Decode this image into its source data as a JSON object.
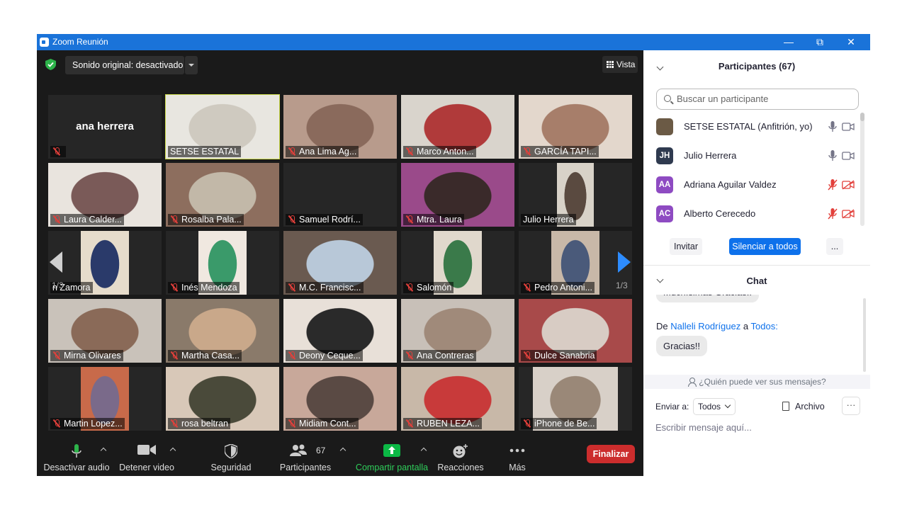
{
  "window": {
    "title": "Zoom Reunión",
    "minimize": "—",
    "restore": "⧉",
    "close": "✕"
  },
  "meeting": {
    "sound_original": "Sonido original: desactivado",
    "view_label": "Vista",
    "page_left": "1/3",
    "page_right": "1/3"
  },
  "tiles": [
    {
      "name": "ana herrera",
      "muted": true,
      "video": false,
      "active": false
    },
    {
      "name": "SETSE ESTATAL",
      "muted": false,
      "video": true,
      "active": true,
      "colors": [
        "#e8e6e0",
        "#cfcac0"
      ]
    },
    {
      "name": "Ana Lima Ag...",
      "muted": true,
      "video": true,
      "colors": [
        "#b89b8c",
        "#8a6a5c"
      ]
    },
    {
      "name": "Marco Anton...",
      "muted": true,
      "video": true,
      "colors": [
        "#d9d4cc",
        "#b03a3a"
      ]
    },
    {
      "name": "GARCÍA TAPI...",
      "muted": true,
      "video": true,
      "colors": [
        "#e3d7cc",
        "#a77e6a"
      ]
    },
    {
      "name": "Laura Calder...",
      "muted": true,
      "video": true,
      "colors": [
        "#e9e4de",
        "#7a5a58"
      ]
    },
    {
      "name": "Rosalba Pala...",
      "muted": true,
      "video": true,
      "colors": [
        "#8d6e5e",
        "#c2b8a8"
      ]
    },
    {
      "name": "Samuel Rodrí...",
      "muted": true,
      "video": false
    },
    {
      "name": "Mtra. Laura",
      "muted": true,
      "video": true,
      "colors": [
        "#9a4a8a",
        "#3a2a2a"
      ]
    },
    {
      "name": "Julio Herrera",
      "muted": false,
      "video": true,
      "colors": [
        "#d8d2c8",
        "#5a4a40"
      ]
    },
    {
      "name": "n Zamora",
      "muted": false,
      "video": true,
      "colors": [
        "#e6dccb",
        "#2a3a6a"
      ]
    },
    {
      "name": "Inés Mendoza",
      "muted": true,
      "video": true,
      "colors": [
        "#f0e8e0",
        "#3a9a6a"
      ]
    },
    {
      "name": "M.C. Francisc...",
      "muted": true,
      "video": true,
      "colors": [
        "#6a5a50",
        "#b8c8d8"
      ]
    },
    {
      "name": "Salomón",
      "muted": true,
      "video": true,
      "colors": [
        "#e0d8cc",
        "#3a7a4a"
      ]
    },
    {
      "name": "Pedro Antoni...",
      "muted": true,
      "video": true,
      "colors": [
        "#c8b8a8",
        "#4a5a7a"
      ]
    },
    {
      "name": "Mirna Olivares",
      "muted": true,
      "video": true,
      "colors": [
        "#c9c2ba",
        "#8a6a58"
      ]
    },
    {
      "name": "Martha Casa...",
      "muted": true,
      "video": true,
      "colors": [
        "#8a7a6a",
        "#c9a88a"
      ]
    },
    {
      "name": "Deony Ceque...",
      "muted": true,
      "video": true,
      "colors": [
        "#e8e0d8",
        "#2a2a2a"
      ]
    },
    {
      "name": "Ana Contreras",
      "muted": true,
      "video": true,
      "colors": [
        "#c8c0b8",
        "#a08a7a"
      ]
    },
    {
      "name": "Dulce Sanabria",
      "muted": true,
      "video": true,
      "colors": [
        "#a84a4a",
        "#d8ccc4"
      ]
    },
    {
      "name": "Martin Lopez...",
      "muted": true,
      "video": true,
      "colors": [
        "#c86a4a",
        "#7a6a8a"
      ]
    },
    {
      "name": "rosa beltran",
      "muted": true,
      "video": true,
      "colors": [
        "#d8c8b8",
        "#4a4a3a"
      ]
    },
    {
      "name": "Midiam Cont...",
      "muted": true,
      "video": true,
      "colors": [
        "#c8a89a",
        "#5a4a44"
      ]
    },
    {
      "name": "RUBEN LEZA...",
      "muted": true,
      "video": true,
      "colors": [
        "#c8b8a8",
        "#c83a3a"
      ]
    },
    {
      "name": "iPhone de Be...",
      "muted": true,
      "video": true,
      "colors": [
        "#d8d0c8",
        "#9a8878"
      ]
    }
  ],
  "toolbar": {
    "mute_audio": "Desactivar audio",
    "stop_video": "Detener video",
    "security": "Seguridad",
    "participants": "Participantes",
    "participants_count": "67",
    "share_screen": "Compartir pantalla",
    "reactions": "Reacciones",
    "more": "Más",
    "end": "Finalizar"
  },
  "participants_panel": {
    "title": "Participantes (67)",
    "search_placeholder": "Buscar un participante",
    "list": [
      {
        "name": "SETSE ESTATAL (Anfitrión, yo)",
        "initials": "",
        "avatar_color": "#6b5a45",
        "mic_muted": false,
        "video_off": false
      },
      {
        "name": "Julio Herrera",
        "initials": "JH",
        "avatar_color": "#2f3a4f",
        "mic_muted": false,
        "video_off": false
      },
      {
        "name": "Adriana Aguilar Valdez",
        "initials": "AA",
        "avatar_color": "#8e4bc2",
        "mic_muted": true,
        "video_off": true
      },
      {
        "name": "Alberto Cerecedo",
        "initials": "AC",
        "avatar_color": "#8e4bc2",
        "mic_muted": true,
        "video_off": true
      }
    ],
    "invite": "Invitar",
    "mute_all": "Silenciar a todos",
    "more": "..."
  },
  "chat_panel": {
    "title": "Chat",
    "prev_message": "Muchísimas Gracias!!",
    "from_prefix": "De",
    "from_name": "Nalleli Rodríguez",
    "to_word": "a",
    "to_name": "Todos:",
    "message": "Gracias!!",
    "who_can_see": "¿Quién puede ver sus mensajes?",
    "send_to_label": "Enviar a:",
    "send_to_value": "Todos",
    "file_label": "Archivo",
    "more": "···",
    "input_placeholder": "Escribir mensaje aquí..."
  },
  "colors": {
    "accent": "#0e71eb",
    "titlebar": "#1a73d9",
    "danger": "#cc2d2d",
    "share": "#0bb845",
    "muted_red": "#e2403b"
  }
}
